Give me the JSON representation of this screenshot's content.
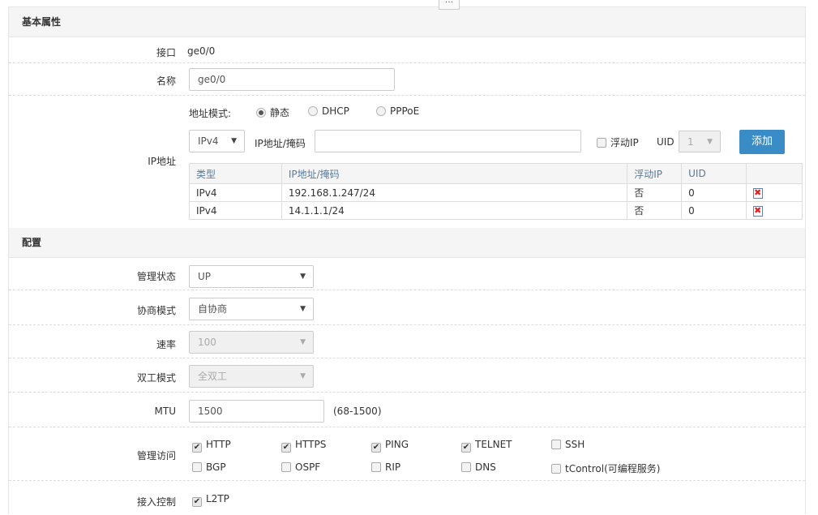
{
  "top_handle": "...",
  "basic": {
    "section_title": "基本属性",
    "interface_label": "接口",
    "interface_value": "ge0/0",
    "name_label": "名称",
    "name_value": "ge0/0",
    "ip_label": "IP地址",
    "addr_mode_label": "地址模式:",
    "addr_modes": [
      {
        "label": "静态",
        "checked": true
      },
      {
        "label": "DHCP",
        "checked": false
      },
      {
        "label": "PPPoE",
        "checked": false
      }
    ],
    "ip_version_value": "IPv4",
    "ip_mask_label": "IP地址/掩码",
    "ip_mask_value": "",
    "floating_ip_label": "浮动IP",
    "uid_label": "UID",
    "uid_value": "1",
    "add_button": "添加",
    "table": {
      "headers": [
        "类型",
        "IP地址/掩码",
        "浮动IP",
        "UID",
        ""
      ],
      "rows": [
        {
          "type": "IPv4",
          "ip": "192.168.1.247/24",
          "floating": "否",
          "uid": "0"
        },
        {
          "type": "IPv4",
          "ip": "14.1.1.1/24",
          "floating": "否",
          "uid": "0"
        }
      ]
    }
  },
  "config": {
    "section_title": "配置",
    "admin_state_label": "管理状态",
    "admin_state_value": "UP",
    "nego_label": "协商模式",
    "nego_value": "自协商",
    "speed_label": "速率",
    "speed_value": "100",
    "duplex_label": "双工模式",
    "duplex_value": "全双工",
    "mtu_label": "MTU",
    "mtu_value": "1500",
    "mtu_hint": "(68-1500)",
    "mgmt_label": "管理访问",
    "mgmt_items": [
      {
        "label": "HTTP",
        "checked": true
      },
      {
        "label": "HTTPS",
        "checked": true
      },
      {
        "label": "PING",
        "checked": true
      },
      {
        "label": "TELNET",
        "checked": true
      },
      {
        "label": "SSH",
        "checked": false
      },
      {
        "label": "BGP",
        "checked": false
      },
      {
        "label": "OSPF",
        "checked": false
      },
      {
        "label": "RIP",
        "checked": false
      },
      {
        "label": "DNS",
        "checked": false
      },
      {
        "label": "tControl(可编程服务)",
        "checked": false
      }
    ],
    "access_label": "接入控制",
    "access_items": [
      {
        "label": "L2TP",
        "checked": true
      }
    ]
  },
  "colors": {
    "accent": "#3a8cc6",
    "header_bg": "#f5f5f5",
    "delete_red": "#dd2222"
  }
}
